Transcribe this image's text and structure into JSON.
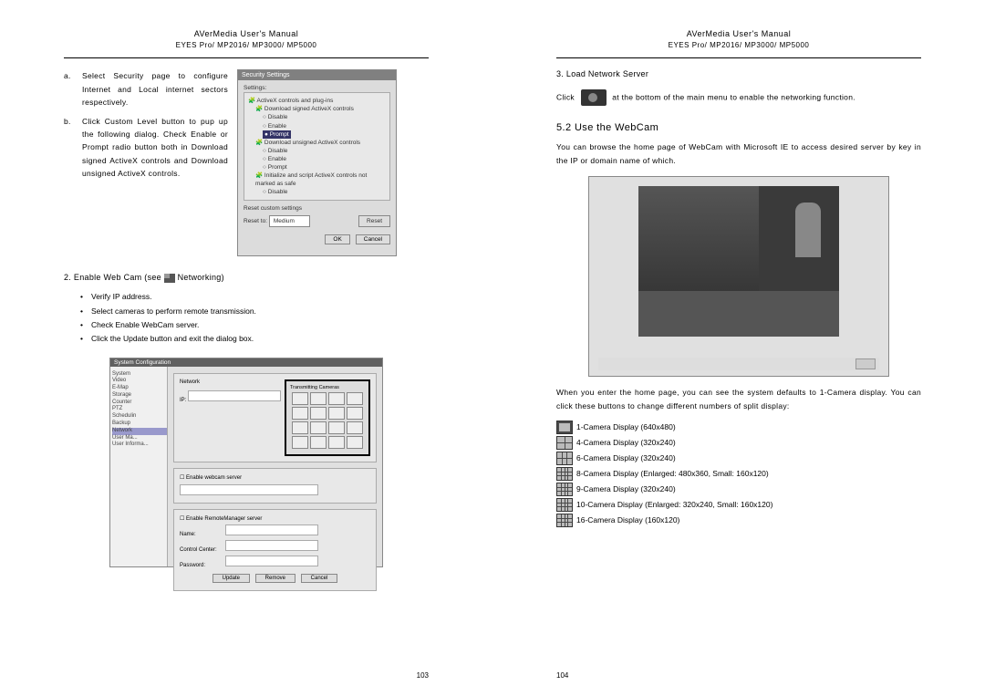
{
  "header": {
    "line1": "AVerMedia User's Manual",
    "line2": "EYES Pro/ MP2016/ MP3000/ MP5000"
  },
  "left": {
    "a": {
      "label": "a.",
      "text": "Select Security page to configure Internet and Local internet sectors respectively."
    },
    "b": {
      "label": "b.",
      "text": "Click Custom Level button to pup up the following dialog. Check Enable or Prompt radio button both in Download signed ActiveX controls and Download unsigned ActiveX controls."
    },
    "dlg": {
      "title": "Security Settings",
      "settings_label": "Settings:",
      "g1": "ActiveX controls and plug-ins",
      "g1a": "Download signed ActiveX controls",
      "opt_disable": "Disable",
      "opt_enable": "Enable",
      "opt_prompt": "Prompt",
      "g1b": "Download unsigned ActiveX controls",
      "g1c": "Initialize and script ActiveX controls not marked as safe",
      "reset_label": "Reset custom settings",
      "reset_to": "Reset to:",
      "reset_val": "Medium",
      "reset_btn": "Reset",
      "ok": "OK",
      "cancel": "Cancel"
    },
    "step2": "2.  Enable Web Cam (see ",
    "step2b": " Networking)",
    "bullets": [
      "Verify IP address.",
      "Select cameras to perform remote transmission.",
      "Check Enable WebCam server.",
      "Click the Update button and exit the dialog box."
    ],
    "sysconf": {
      "title": "System Configuration",
      "tree": [
        "System",
        "Video",
        "E-Map",
        "Storage",
        "Counter",
        "PTZ",
        "Schedulin",
        "Backup",
        "Network",
        "User Ma...",
        "User Informa..."
      ],
      "network": "Network",
      "transmitting": "Transmitting Cameras",
      "enable_ws": "Enable webcam server",
      "ip": "IP:",
      "ipval": "",
      "enable_rt": "Enable RemoteManager server",
      "name": "Name:",
      "cc": "Control Center:",
      "pw": "Password:",
      "update": "Update",
      "remove": "Remove",
      "cancel": "Cancel"
    },
    "pagenum": "103"
  },
  "right": {
    "step3": "3.  Load Network Server",
    "step3text_a": "Click",
    "step3text_b": "at the bottom of the main menu to enable the networking function.",
    "section52": "5.2 Use the WebCam",
    "section52text": "You can browse the home page of WebCam with Microsoft IE to access desired server by key in the IP or domain name of which.",
    "afterimg": "When you enter the home page, you can see the system defaults to 1-Camera display.  You can click these buttons to change different numbers of split display:",
    "displays": [
      "1-Camera Display (640x480)",
      "4-Camera Display (320x240)",
      "6-Camera Display (320x240)",
      "8-Camera Display (Enlarged: 480x360, Small: 160x120)",
      "9-Camera Display (320x240)",
      "10-Camera Display (Enlarged: 320x240, Small: 160x120)",
      "16-Camera Display (160x120)"
    ],
    "pagenum": "104"
  }
}
